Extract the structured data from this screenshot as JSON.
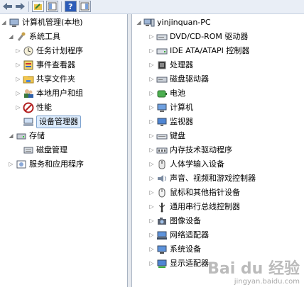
{
  "colors": {
    "selection_bg": "#dcebfc",
    "selection_border": "#7da2ce",
    "toolbar_bg": "#e9eef6"
  },
  "toolbar": {
    "buttons": [
      {
        "name": "back-arrow-icon"
      },
      {
        "name": "forward-arrow-icon"
      },
      {
        "name": "up-folder-icon"
      },
      {
        "name": "show-hide-tree-icon"
      },
      {
        "name": "help-icon"
      },
      {
        "name": "action-pane-icon"
      }
    ]
  },
  "left_tree": {
    "items": [
      {
        "label": "计算机管理(本地)",
        "icon": "computer-management-icon",
        "expander": "◢"
      },
      {
        "label": "系统工具",
        "icon": "system-tools-icon",
        "expander": "◢"
      },
      {
        "label": "任务计划程序",
        "icon": "task-scheduler-icon",
        "expander": "▷"
      },
      {
        "label": "事件查看器",
        "icon": "event-viewer-icon",
        "expander": "▷"
      },
      {
        "label": "共享文件夹",
        "icon": "shared-folders-icon",
        "expander": "▷"
      },
      {
        "label": "本地用户和组",
        "icon": "local-users-icon",
        "expander": "▷"
      },
      {
        "label": "性能",
        "icon": "performance-icon",
        "expander": "▷"
      },
      {
        "label": "设备管理器",
        "icon": "device-manager-icon",
        "expander": "",
        "selected": true
      },
      {
        "label": "存储",
        "icon": "storage-icon",
        "expander": "◢"
      },
      {
        "label": "磁盘管理",
        "icon": "disk-management-icon",
        "expander": ""
      },
      {
        "label": "服务和应用程序",
        "icon": "services-apps-icon",
        "expander": "▷"
      }
    ]
  },
  "device_tree": {
    "root": {
      "label": "yinjinquan-PC",
      "icon": "pc-icon",
      "expander": "◢"
    },
    "items": [
      {
        "label": "DVD/CD-ROM 驱动器",
        "icon": "dvd-drive-icon"
      },
      {
        "label": "IDE ATA/ATAPI 控制器",
        "icon": "ide-controller-icon"
      },
      {
        "label": "处理器",
        "icon": "processor-icon"
      },
      {
        "label": "磁盘驱动器",
        "icon": "disk-drive-icon"
      },
      {
        "label": "电池",
        "icon": "battery-icon"
      },
      {
        "label": "计算机",
        "icon": "computer-icon"
      },
      {
        "label": "监视器",
        "icon": "monitor-icon"
      },
      {
        "label": "键盘",
        "icon": "keyboard-icon"
      },
      {
        "label": "内存技术驱动程序",
        "icon": "memory-tech-icon"
      },
      {
        "label": "人体学输入设备",
        "icon": "hid-icon"
      },
      {
        "label": "声音、视频和游戏控制器",
        "icon": "sound-icon"
      },
      {
        "label": "鼠标和其他指针设备",
        "icon": "mouse-icon"
      },
      {
        "label": "通用串行总线控制器",
        "icon": "usb-icon"
      },
      {
        "label": "图像设备",
        "icon": "imaging-device-icon"
      },
      {
        "label": "网络适配器",
        "icon": "network-adapter-icon"
      },
      {
        "label": "系统设备",
        "icon": "system-devices-icon"
      },
      {
        "label": "显示适配器",
        "icon": "display-adapter-icon"
      }
    ]
  },
  "watermark": {
    "brand": "Bai du 经验",
    "url": "jingyan.baidu.com"
  }
}
